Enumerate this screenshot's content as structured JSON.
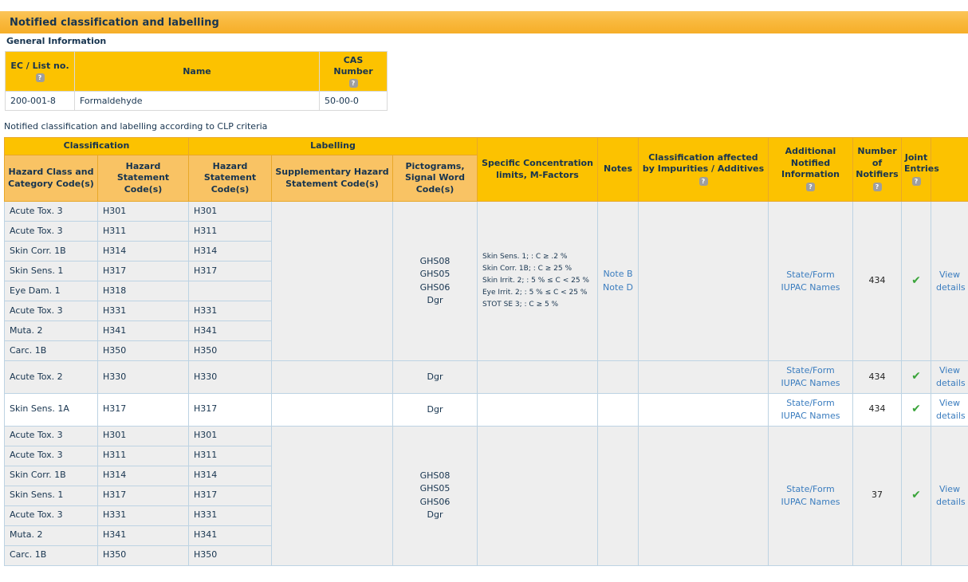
{
  "banner": {
    "title": "Notified classification and labelling"
  },
  "section_label": "General Information",
  "general_info": {
    "headers": {
      "ec": "EC / List no.",
      "name": "Name",
      "cas": "CAS Number"
    },
    "row": {
      "ec": "200-001-8",
      "name": "Formaldehyde",
      "cas": "50-00-0"
    }
  },
  "clp_caption": "Notified classification and labelling according to CLP criteria",
  "clp_headers": {
    "group_classification": "Classification",
    "group_labelling": "Labelling",
    "hazard_class_category": "Hazard Class and Category Code(s)",
    "hazard_statement_1": "Hazard Statement Code(s)",
    "hazard_statement_2": "Hazard Statement Code(s)",
    "supplementary": "Supplementary Hazard Statement Code(s)",
    "pictograms": "Pictograms, Signal Word Code(s)",
    "specific_conc": "Specific Concentration limits, M-Factors",
    "notes": "Notes",
    "impurities": "Classification affected by Impurities / Additives",
    "additional_info": "Additional Notified Information",
    "number_notifiers": "Number of Notifiers",
    "joint_entries": "Joint Entries",
    "blank": ""
  },
  "icons": {
    "help": "?",
    "check": "✔"
  },
  "blocks": [
    {
      "shaded": true,
      "rows": [
        {
          "hcc": "Acute Tox. 3",
          "hs1": "H301",
          "hs2": "H301"
        },
        {
          "hcc": "Acute Tox. 3",
          "hs1": "H311",
          "hs2": "H311"
        },
        {
          "hcc": "Skin Corr. 1B",
          "hs1": "H314",
          "hs2": "H314"
        },
        {
          "hcc": "Skin Sens. 1",
          "hs1": "H317",
          "hs2": "H317"
        },
        {
          "hcc": "Eye Dam. 1",
          "hs1": "H318",
          "hs2": ""
        },
        {
          "hcc": "Acute Tox. 3",
          "hs1": "H331",
          "hs2": "H331"
        },
        {
          "hcc": "Muta. 2",
          "hs1": "H341",
          "hs2": "H341"
        },
        {
          "hcc": "Carc. 1B",
          "hs1": "H350",
          "hs2": "H350"
        }
      ],
      "supplementary": "",
      "pictograms": [
        "GHS08",
        "GHS05",
        "GHS06",
        "Dgr"
      ],
      "specific_conc": [
        "Skin Sens. 1; : C ≥ .2 %",
        "Skin Corr. 1B; : C ≥ 25 %",
        "Skin Irrit. 2; : 5 % ≤ C < 25 %",
        "Eye Irrit. 2; : 5 % ≤ C < 25 %",
        "STOT SE 3; : C ≥ 5 %"
      ],
      "notes": [
        "Note B",
        "Note D"
      ],
      "impurities": "",
      "additional_info": [
        "State/Form",
        "IUPAC Names"
      ],
      "number_notifiers": "434",
      "joint_entries": true,
      "view_details": [
        "View",
        "details"
      ]
    },
    {
      "shaded": true,
      "rows": [
        {
          "hcc": "Acute Tox. 2",
          "hs1": "H330",
          "hs2": "H330"
        }
      ],
      "supplementary": "",
      "pictograms": [
        "Dgr"
      ],
      "specific_conc": [],
      "notes": [],
      "impurities": "",
      "additional_info": [
        "State/Form",
        "IUPAC Names"
      ],
      "number_notifiers": "434",
      "joint_entries": true,
      "view_details": [
        "View",
        "details"
      ]
    },
    {
      "shaded": false,
      "rows": [
        {
          "hcc": "Skin Sens. 1A",
          "hs1": "H317",
          "hs2": "H317"
        }
      ],
      "supplementary": "",
      "pictograms": [
        "Dgr"
      ],
      "specific_conc": [],
      "notes": [],
      "impurities": "",
      "additional_info": [
        "State/Form",
        "IUPAC Names"
      ],
      "number_notifiers": "434",
      "joint_entries": true,
      "view_details": [
        "View",
        "details"
      ]
    },
    {
      "shaded": true,
      "rows": [
        {
          "hcc": "Acute Tox. 3",
          "hs1": "H301",
          "hs2": "H301"
        },
        {
          "hcc": "Acute Tox. 3",
          "hs1": "H311",
          "hs2": "H311"
        },
        {
          "hcc": "Skin Corr. 1B",
          "hs1": "H314",
          "hs2": "H314"
        },
        {
          "hcc": "Skin Sens. 1",
          "hs1": "H317",
          "hs2": "H317"
        },
        {
          "hcc": "Acute Tox. 3",
          "hs1": "H331",
          "hs2": "H331"
        },
        {
          "hcc": "Muta. 2",
          "hs1": "H341",
          "hs2": "H341"
        },
        {
          "hcc": "Carc. 1B",
          "hs1": "H350",
          "hs2": "H350"
        }
      ],
      "supplementary": "",
      "pictograms": [
        "GHS08",
        "GHS05",
        "GHS06",
        "Dgr"
      ],
      "specific_conc": [],
      "notes": [],
      "impurities": "",
      "additional_info": [
        "State/Form",
        "IUPAC Names"
      ],
      "number_notifiers": "37",
      "joint_entries": true,
      "view_details": [
        "View",
        "details"
      ]
    }
  ]
}
